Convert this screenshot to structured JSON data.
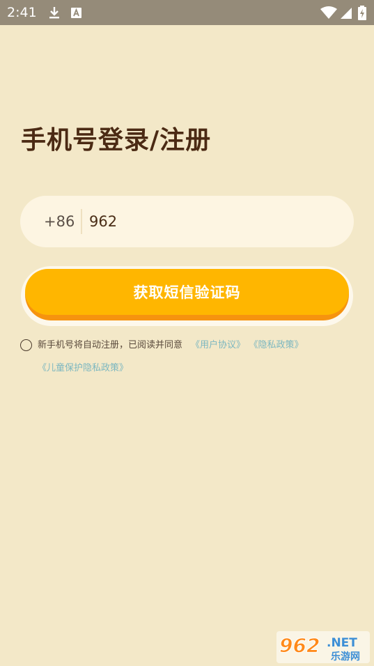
{
  "status_bar": {
    "time": "2:41",
    "icons": [
      "download-icon",
      "font-a-icon",
      "wifi-icon",
      "signal-icon",
      "battery-icon"
    ]
  },
  "title": "手机号登录/注册",
  "phone_field": {
    "country_code": "+86",
    "value": "962"
  },
  "code_button": {
    "label": "获取短信验证码"
  },
  "agreement": {
    "text": "新手机号将自动注册，已阅读并同意",
    "links": [
      "《用户协议》",
      "《隐私政策》",
      "《儿童保护隐私政策》"
    ]
  },
  "watermark": {
    "brand": "962",
    "suffix": ".NET",
    "subtitle": "乐游网"
  },
  "colors": {
    "background": "#f3e8c8",
    "status_bar": "#958b79",
    "title": "#4b2a14",
    "button": "#ffb600",
    "button_shadow": "#f6930f",
    "link": "#7cb7c0"
  }
}
